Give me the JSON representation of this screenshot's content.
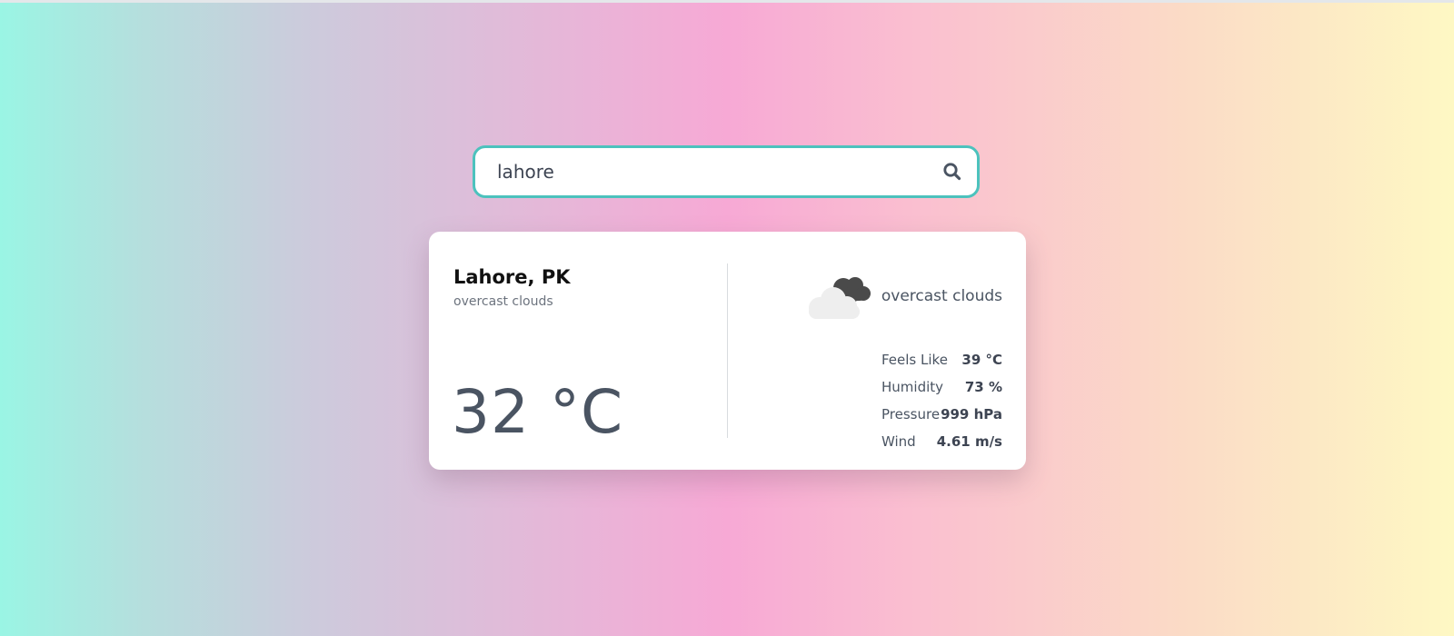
{
  "search": {
    "value": "lahore",
    "icon": "search-icon",
    "border_color": "#4cc2bd"
  },
  "weather": {
    "location": "Lahore, PK",
    "description": "overcast clouds",
    "temperature": "32 °C",
    "icon": "overcast-clouds-icon",
    "condition_label": "overcast clouds",
    "details": [
      {
        "label": "Feels Like",
        "value": "39 °C"
      },
      {
        "label": "Humidity",
        "value": "73 %"
      },
      {
        "label": "Pressure",
        "value": "999 hPa"
      },
      {
        "label": "Wind",
        "value": "4.61 m/s"
      }
    ]
  }
}
